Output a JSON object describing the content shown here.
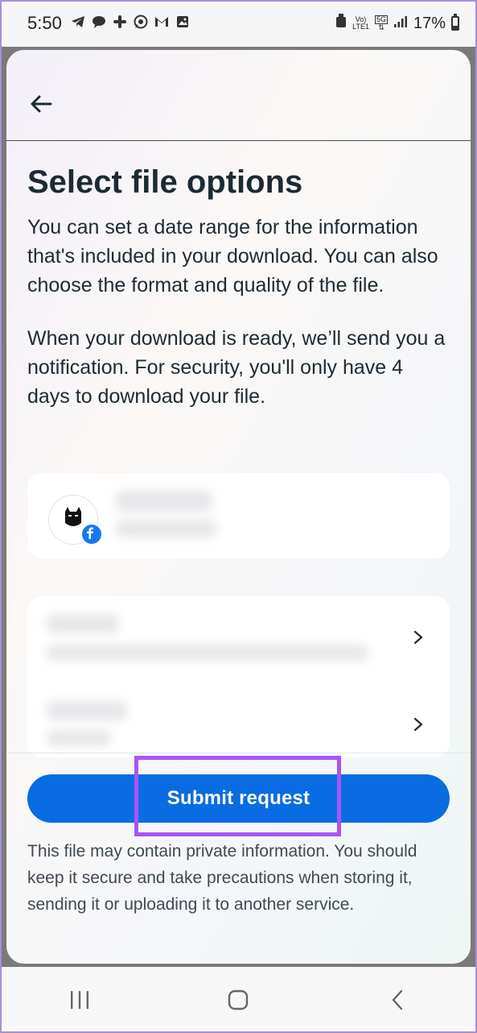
{
  "status_bar": {
    "time": "5:50",
    "left_icons": [
      "telegram-icon",
      "chat-icon",
      "slack-icon",
      "whatsapp-icon",
      "gmail-icon",
      "gallery-icon"
    ],
    "net_top": "Vo)",
    "net_bottom": "LTE1",
    "net_5g": "5G",
    "battery_percent": "17%"
  },
  "sheet": {
    "title": "Select file options",
    "paragraph_1": "You can set a date range for the information that's included in your download. You can also choose the format and quality of the file.",
    "paragraph_2": "When your download is ready, we’ll send you a notification. For security, you'll only have 4 days to download your file.",
    "submit_label": "Submit request",
    "disclaimer": "This file may contain private information. You should keep it secure and take precautions when storing it, sending it or uploading it to another service."
  },
  "colors": {
    "primary_button": "#0a6ce2",
    "highlight": "#a855f7",
    "facebook_blue": "#1877f2"
  }
}
